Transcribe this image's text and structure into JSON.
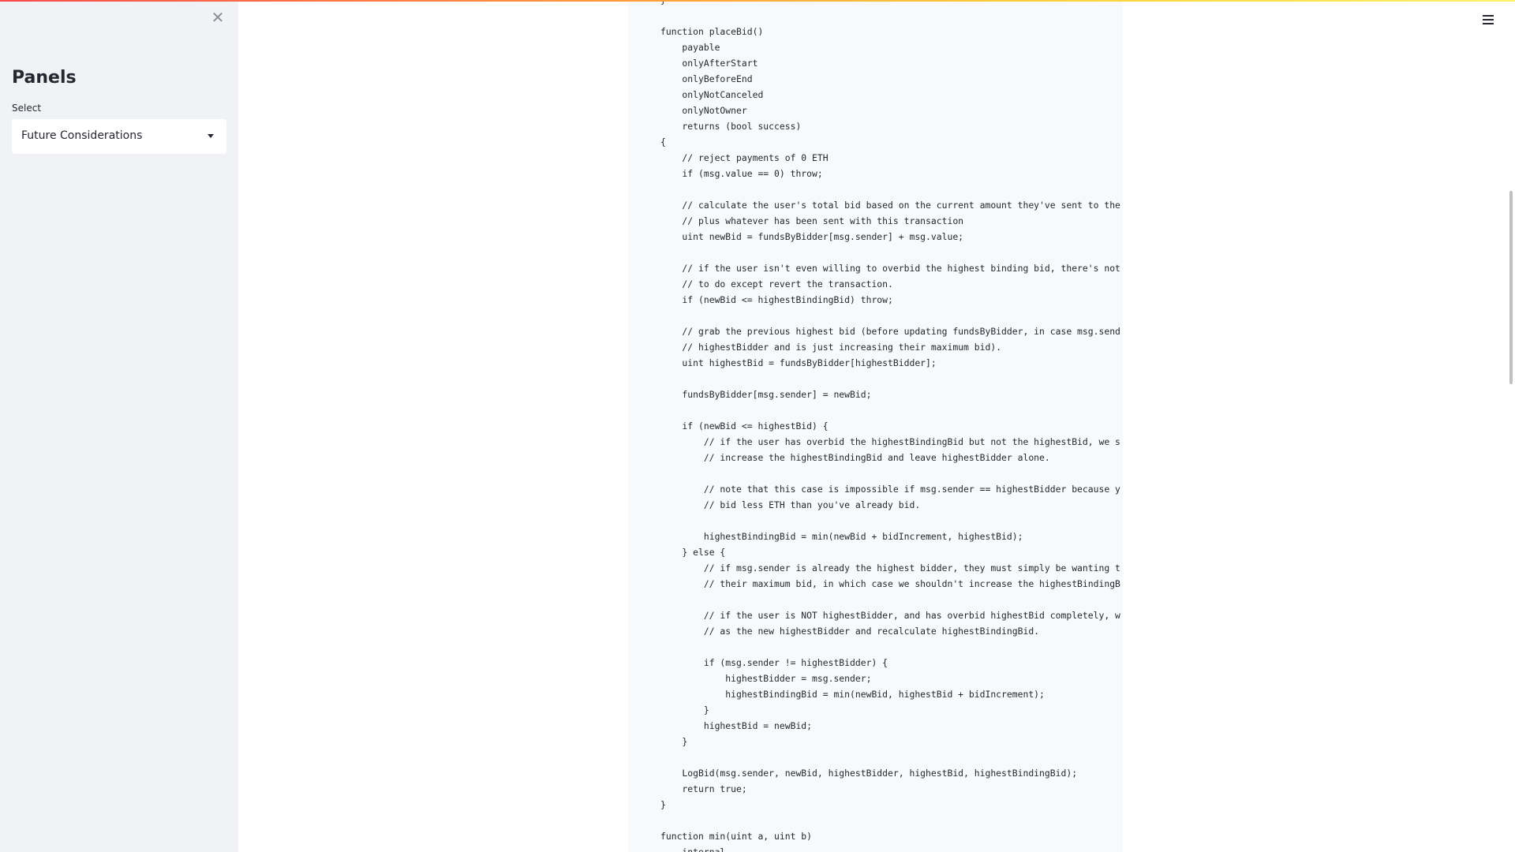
{
  "sidebar": {
    "title": "Panels",
    "select_label": "Select",
    "select_value": "Future Considerations",
    "close_icon": "close-icon"
  },
  "header": {
    "menu_icon": "hamburger-menu-icon"
  },
  "colors": {
    "accent_gradient_start": "#ff4b4b",
    "accent_gradient_end": "#fff26a",
    "sidebar_bg": "#f0f2f6",
    "code_bg": "#f8f9fb",
    "text": "#262730"
  },
  "code": {
    "lines": [
      "}",
      "",
      "function placeBid()",
      "    payable",
      "    onlyAfterStart",
      "    onlyBeforeEnd",
      "    onlyNotCanceled",
      "    onlyNotOwner",
      "    returns (bool success)",
      "{",
      "    // reject payments of 0 ETH",
      "    if (msg.value == 0) throw;",
      "",
      "    // calculate the user's total bid based on the current amount they've sent to the",
      "    // plus whatever has been sent with this transaction",
      "    uint newBid = fundsByBidder[msg.sender] + msg.value;",
      "",
      "    // if the user isn't even willing to overbid the highest binding bid, there's not",
      "    // to do except revert the transaction.",
      "    if (newBid <= highestBindingBid) throw;",
      "",
      "    // grab the previous highest bid (before updating fundsByBidder, in case msg.send",
      "    // highestBidder and is just increasing their maximum bid).",
      "    uint highestBid = fundsByBidder[highestBidder];",
      "",
      "    fundsByBidder[msg.sender] = newBid;",
      "",
      "    if (newBid <= highestBid) {",
      "        // if the user has overbid the highestBindingBid but not the highestBid, we s",
      "        // increase the highestBindingBid and leave highestBidder alone.",
      "",
      "        // note that this case is impossible if msg.sender == highestBidder because y",
      "        // bid less ETH than you've already bid.",
      "",
      "        highestBindingBid = min(newBid + bidIncrement, highestBid);",
      "    } else {",
      "        // if msg.sender is already the highest bidder, they must simply be wanting t",
      "        // their maximum bid, in which case we shouldn't increase the highestBindingB",
      "",
      "        // if the user is NOT highestBidder, and has overbid highestBid completely, w",
      "        // as the new highestBidder and recalculate highestBindingBid.",
      "",
      "        if (msg.sender != highestBidder) {",
      "            highestBidder = msg.sender;",
      "            highestBindingBid = min(newBid, highestBid + bidIncrement);",
      "        }",
      "        highestBid = newBid;",
      "    }",
      "",
      "    LogBid(msg.sender, newBid, highestBidder, highestBid, highestBindingBid);",
      "    return true;",
      "}",
      "",
      "function min(uint a, uint b)",
      "    internal"
    ]
  }
}
